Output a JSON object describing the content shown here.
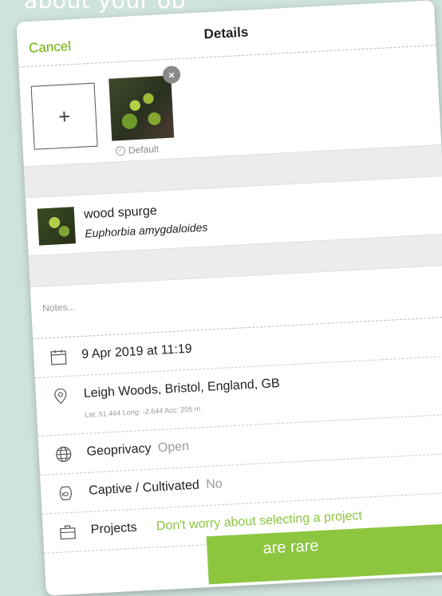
{
  "caption": "about your ob",
  "nav": {
    "cancel": "Cancel",
    "title": "Details"
  },
  "photos": {
    "add": "+",
    "remove": "×",
    "default_label": "Default"
  },
  "species": {
    "common_name": "wood spurge",
    "scientific_name": "Euphorbia amygdaloides"
  },
  "notes": {
    "placeholder": "Notes..."
  },
  "rows": {
    "date": {
      "text": "9 Apr 2019 at 11:19",
      "icon": "calendar-icon"
    },
    "location": {
      "text": "Leigh Woods, Bristol, England, GB",
      "sub": "Lat: 51.464  Long: -2.644  Acc: 205 m",
      "icon": "location-pin-icon"
    },
    "geoprivacy": {
      "label": "Geoprivacy",
      "value": "Open",
      "icon": "globe-icon"
    },
    "captive": {
      "label": "Captive / Cultivated",
      "value": "No",
      "icon": "fishbowl-icon"
    },
    "projects": {
      "label": "Projects",
      "value": "Don't worry about selecting a project",
      "icon": "briefcase-icon"
    }
  },
  "banner": {
    "text": "are rare"
  },
  "colors": {
    "accent": "#74ac00",
    "banner": "#8cc63f",
    "muted": "#9a9a9a"
  }
}
